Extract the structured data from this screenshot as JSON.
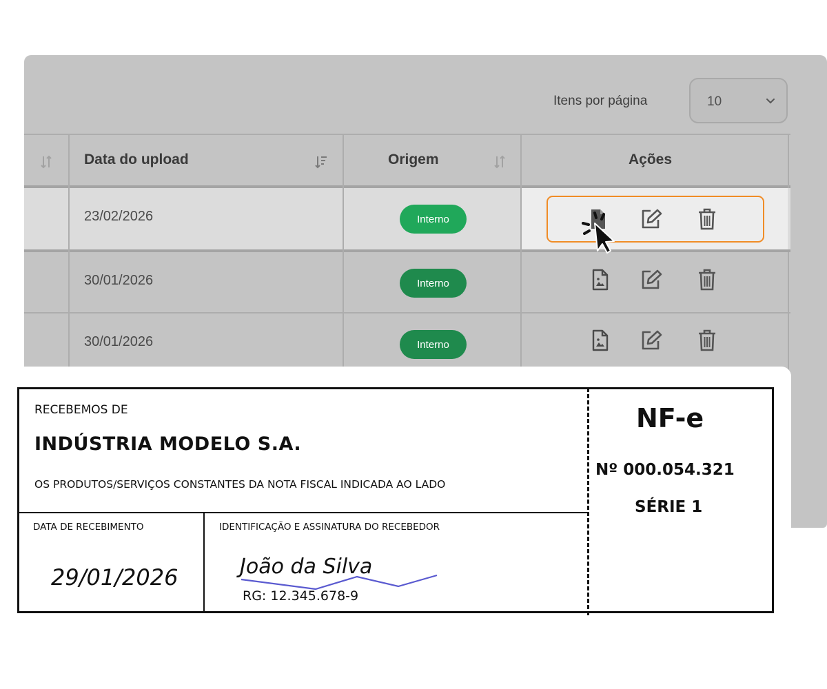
{
  "table": {
    "items_per_page_label": "Itens por página",
    "items_per_page_value": "10",
    "columns": {
      "date": "Data do upload",
      "origin": "Origem",
      "actions": "Ações"
    },
    "rows": [
      {
        "date": "23/02/2026",
        "origin": "Interno"
      },
      {
        "date": "30/01/2026",
        "origin": "Interno"
      },
      {
        "date": "30/01/2026",
        "origin": "Interno"
      }
    ],
    "icons": [
      "sort-icon",
      "sort-desc-icon",
      "file-image-icon",
      "edit-icon",
      "trash-icon",
      "chevron-down-icon",
      "cursor-click-icon"
    ],
    "colors": {
      "badge": "#20a85a",
      "badge_dim": "#1f8a4d",
      "highlight": "#f08c26"
    }
  },
  "receipt": {
    "received_from_label": "RECEBEMOS DE",
    "company": "INDÚSTRIA MODELO S.A.",
    "products_text": "OS PRODUTOS/SERVIÇOS CONSTANTES DA NOTA FISCAL INDICADA AO LADO",
    "receipt_date_label": "DATA DE RECEBIMENTO",
    "id_signature_label": "IDENTIFICAÇÃO E ASSINATURA DO RECEBEDOR",
    "receipt_date": "29/01/2026",
    "signature_name": "João da Silva",
    "signature_rg": "RG: 12.345.678-9",
    "doc_title": "NF-e",
    "doc_number": "Nº 000.054.321",
    "doc_series": "SÉRIE 1"
  }
}
